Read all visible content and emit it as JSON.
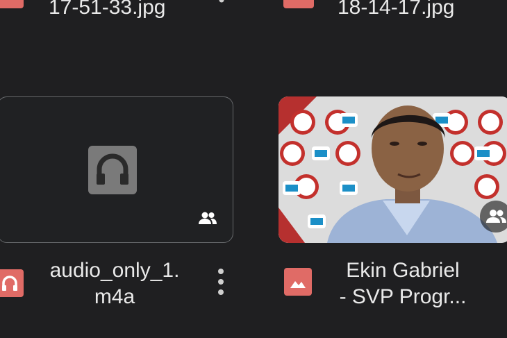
{
  "top_row": {
    "left_filename": "17-51-33.jpg",
    "right_filename": "18-14-17.jpg"
  },
  "tiles": [
    {
      "type": "audio",
      "name_line1": "audio_only_1.",
      "name_line2": "m4a",
      "thumb_icon": "headphones-icon",
      "badge_icon": "people-icon",
      "file_type_icon": "headphones-icon"
    },
    {
      "type": "image",
      "name_line1": "Ekin Gabriel",
      "name_line2": "- SVP Progr...",
      "badge_icon": "people-icon",
      "file_type_icon": "image-icon"
    }
  ],
  "colors": {
    "background": "#1f1f21",
    "accent_red": "#e06b66",
    "text": "#e9e9e9",
    "tile_border": "#67696c"
  }
}
